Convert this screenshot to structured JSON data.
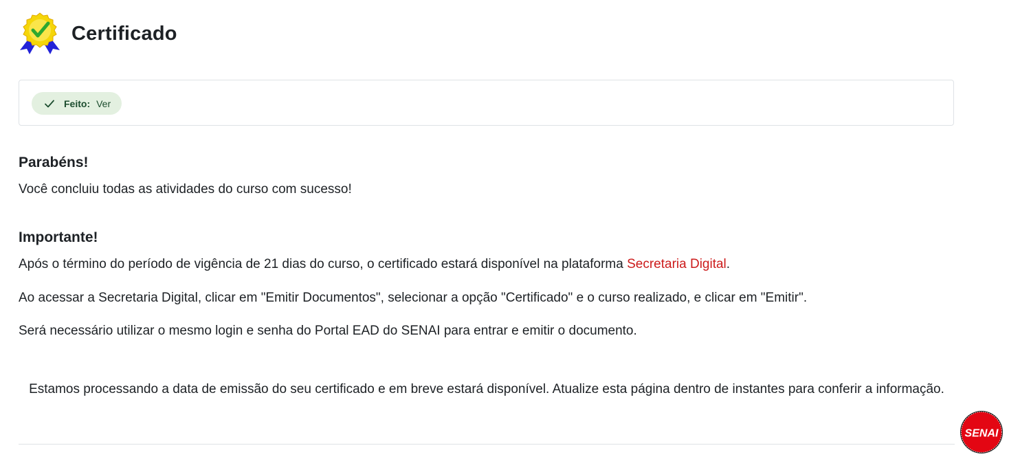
{
  "header": {
    "title": "Certificado",
    "icon": "certificate-award-icon"
  },
  "completion": {
    "status_label": "Feito:",
    "status_value": "Ver",
    "icon": "check-icon",
    "color": "#e3f0e0"
  },
  "congrats": {
    "heading": "Parabéns!",
    "text": "Você concluiu todas as atividades do curso com sucesso!"
  },
  "important": {
    "heading": "Importante!",
    "p1_before": "Após o término do período de vigência de 21 dias do curso, o certificado estará disponível na plataforma ",
    "p1_link": "Secretaria Digital",
    "p1_after": ".",
    "p2": "Ao acessar a Secretaria Digital, clicar em \"Emitir Documentos\", selecionar a opção \"Certificado\" e o curso realizado, e clicar em \"Emitir\".",
    "p3": "Será necessário utilizar o mesmo login e senha do Portal EAD do SENAI para entrar e emitir o documento."
  },
  "notice": {
    "text": "Estamos processando a data de emissão do seu certificado e em breve estará disponível. Atualize esta página dentro de instantes para conferir a informação."
  },
  "brand": {
    "logo_text": "SENAI",
    "color": "#e30613",
    "link_color": "#cc1b1b"
  }
}
